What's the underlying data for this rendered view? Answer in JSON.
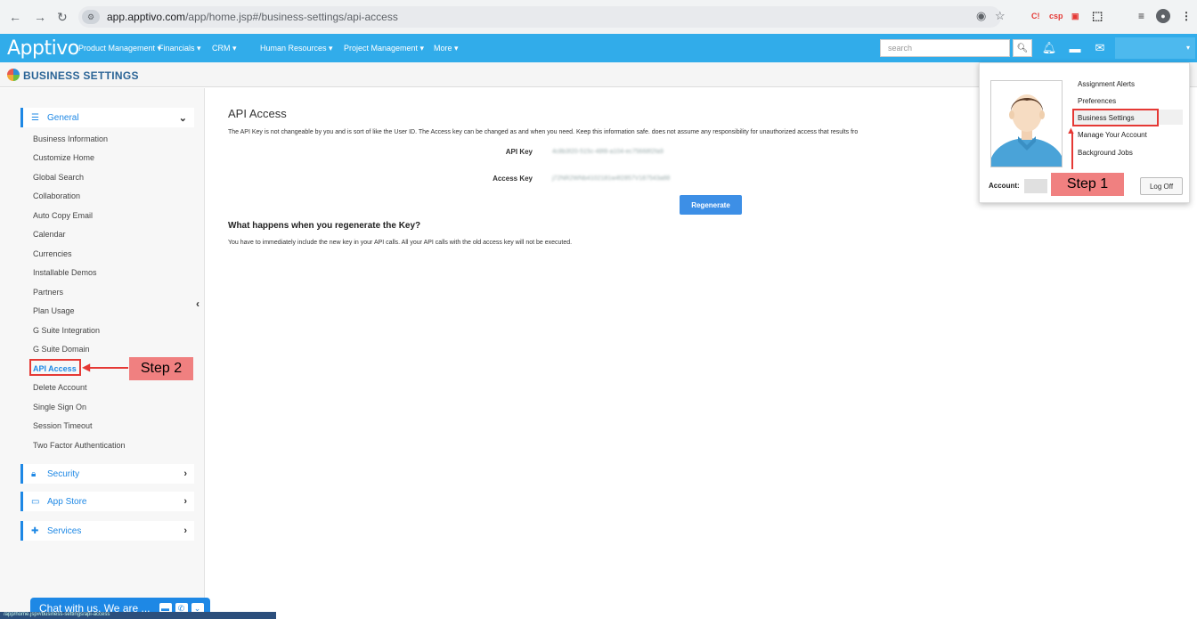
{
  "browser": {
    "url_host": "app.apptivo.com",
    "url_path": "/app/home.jsp#/business-settings/api-access"
  },
  "app": {
    "logo": "Apptivo",
    "menus": [
      "Product Management ▾",
      "Financials ▾",
      "CRM ▾",
      "Human Resources ▾",
      "Project Management ▾",
      "More ▾"
    ],
    "search_placeholder": "search"
  },
  "header": {
    "title": "BUSINESS SETTINGS"
  },
  "sidebar": {
    "general": {
      "label": "General",
      "items": [
        "Business Information",
        "Customize Home",
        "Global Search",
        "Collaboration",
        "Auto Copy Email",
        "Calendar",
        "Currencies",
        "Installable Demos",
        "Partners",
        "Plan Usage",
        "G Suite Integration",
        "G Suite Domain",
        "API Access",
        "Delete Account",
        "Single Sign On",
        "Session Timeout",
        "Two Factor Authentication"
      ]
    },
    "sections": [
      "Security",
      "App Store",
      "Services"
    ]
  },
  "main": {
    "title": "API Access",
    "desc": "The API Key is not changeable by you and is sort of like the User ID. The Access key can be changed as and when you need. Keep this information safe. does not assume any responsibility for unauthorized access that results fro",
    "api_key_label": "API Key",
    "api_key_value": "4c8b3f20-515c-48f8-a104-ec75668f2fa9",
    "access_key_label": "Access Key",
    "access_key_value": "j72NR2WNb4102181w4f2857V187543a88",
    "regenerate_label": "Regenerate",
    "question": "What happens when you regenerate the Key?",
    "answer": "You have to immediately include the new key in your API calls. All your API calls with the old access key will not be executed."
  },
  "dropdown": {
    "items": [
      "Assignment Alerts",
      "Preferences",
      "Business Settings",
      "Manage Your Account",
      "Background Jobs"
    ],
    "account_label": "Account:",
    "logoff_label": "Log Off"
  },
  "annotations": {
    "step1": "Step  1",
    "step2": "Step 2"
  },
  "chat": {
    "label": "Chat with us. We are ..."
  },
  "colors": {
    "topbar": "#31acea",
    "accent": "#1e88e5",
    "step_bg": "#f08080",
    "highlight": "#e53935"
  }
}
